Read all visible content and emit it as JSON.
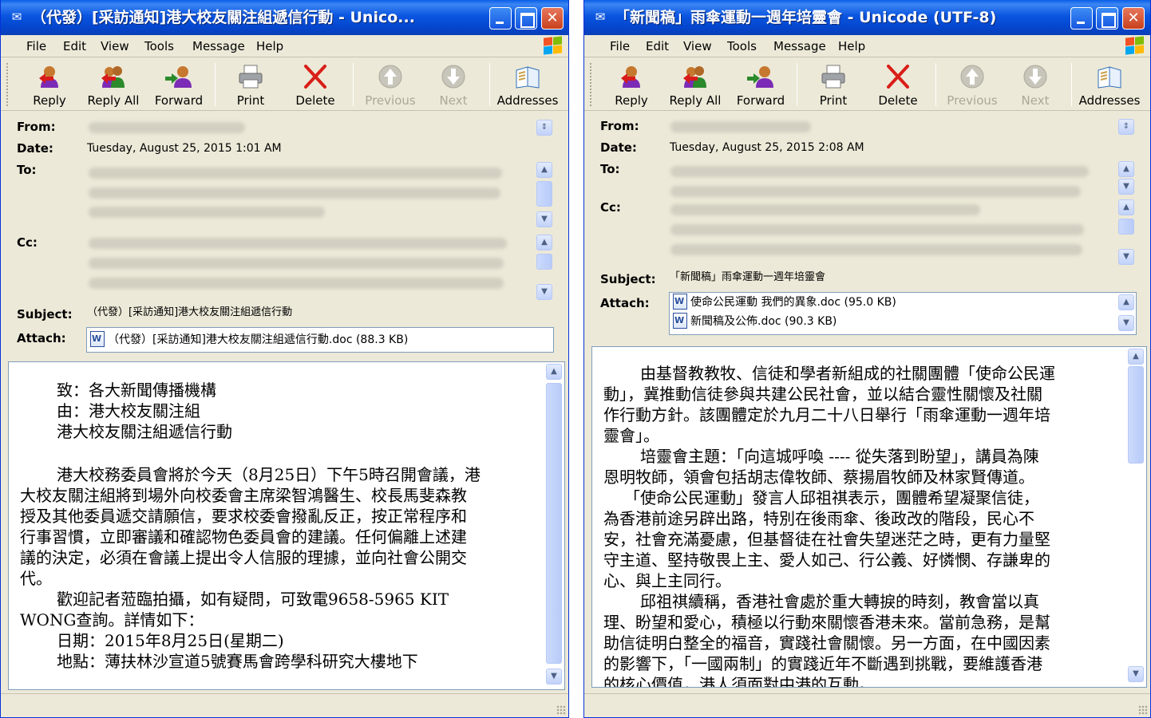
{
  "colors": {
    "titlebar": "#0a55e0",
    "chrome": "#ece9d8",
    "delete_red": "#d91e18",
    "border": "#7f9db9"
  },
  "windows": [
    {
      "title": "（代發）[采訪通知]港大校友關注組遞信行動 - Unico...",
      "controls": {
        "minimize": "minimize",
        "maximize": "maximize",
        "close": "close"
      },
      "menu": [
        "File",
        "Edit",
        "View",
        "Tools",
        "Message",
        "Help"
      ],
      "toolbar": [
        "Reply",
        "Reply All",
        "Forward",
        "Print",
        "Delete",
        "Previous",
        "Next",
        "Addresses"
      ],
      "header_labels": {
        "from": "From:",
        "date": "Date:",
        "to": "To:",
        "cc": "Cc:",
        "subject": "Subject:",
        "attach": "Attach:"
      },
      "date": "Tuesday, August 25, 2015 1:01 AM",
      "subject": "（代發）[采訪通知]港大校友關注組遞信行動",
      "attachments": [
        "（代發）[采訪通知]港大校友關注組遞信行動.doc (88.3 KB)"
      ],
      "body_lines": [
        "致：各大新聞傳播機構",
        "由：港大校友關注組",
        "港大校友關注組遞信行動",
        "港大校務委員會將於今天（8月25日）下午5時召開會議，港",
        "大校友關注組將到場外向校委會主席梁智鴻醫生、校長馬斐森教",
        "授及其他委員遞交請願信，要求校委會撥亂反正，按正常程序和",
        "行事習慣，立即審議和確認物色委員會的建議。任何偏離上述建",
        "議的決定，必須在會議上提出令人信服的理據，並向社會公開交",
        "代。",
        "歡迎記者蒞臨拍攝，如有疑問，可致電9658-5965 KIT",
        "WONG查詢。詳情如下：",
        "日期：2015年8月25日(星期二)",
        "地點：薄扶林沙宣道5號賽馬會跨學科研究大樓地下"
      ]
    },
    {
      "title": "「新聞稿」雨傘運動一週年培靈會 - Unicode (UTF-8)",
      "controls": {
        "minimize": "minimize",
        "maximize": "maximize",
        "close": "close"
      },
      "menu": [
        "File",
        "Edit",
        "View",
        "Tools",
        "Message",
        "Help"
      ],
      "toolbar": [
        "Reply",
        "Reply All",
        "Forward",
        "Print",
        "Delete",
        "Previous",
        "Next",
        "Addresses"
      ],
      "header_labels": {
        "from": "From:",
        "date": "Date:",
        "to": "To:",
        "cc": "Cc:",
        "subject": "Subject:",
        "attach": "Attach:"
      },
      "date": "Tuesday, August 25, 2015 2:08 AM",
      "subject": "「新聞稿」雨傘運動一週年培靈會",
      "attachments": [
        "使命公民運動 我們的異象.doc (95.0 KB)",
        "新聞稿及公佈.doc (90.3 KB)"
      ],
      "body_lines": [
        "由基督教教牧、信徒和學者新組成的社關團體「使命公民運",
        "動」，冀推動信徒參與共建公民社會，並以結合靈性關懷及社關",
        "作行動方針。該團體定於九月二十八日舉行「雨傘運動一週年培",
        "靈會」。",
        "培靈會主題：「向這城呼喚 ---- 從失落到盼望」，講員為陳",
        "恩明牧師，領會包括胡志偉牧師、蔡揚眉牧師及林家賢傳道。",
        "「使命公民運動」發言人邱祖祺表示，團體希望凝聚信徒，",
        "為香港前途另辟出路，特別在後雨傘、後政改的階段，民心不",
        "安，社會充滿憂慮，但基督徒在社會失望迷茫之時，更有力量堅",
        "守主道、堅持敬畏上主、愛人如己、行公義、好憐憫、存謙卑的",
        "心、與上主同行。",
        "邱祖祺續稱，香港社會處於重大轉捩的時刻，教會當以真",
        "理、盼望和愛心，積極以行動來關懷香港未來。當前急務，是幫",
        "助信徒明白整全的福音，實踐社會關懷。另一方面，在中國因素",
        "的影響下，「一國兩制」的實踐近年不斷遇到挑戰，要維護香港",
        "的核心價值，港人須面對中港的互動。"
      ]
    }
  ]
}
